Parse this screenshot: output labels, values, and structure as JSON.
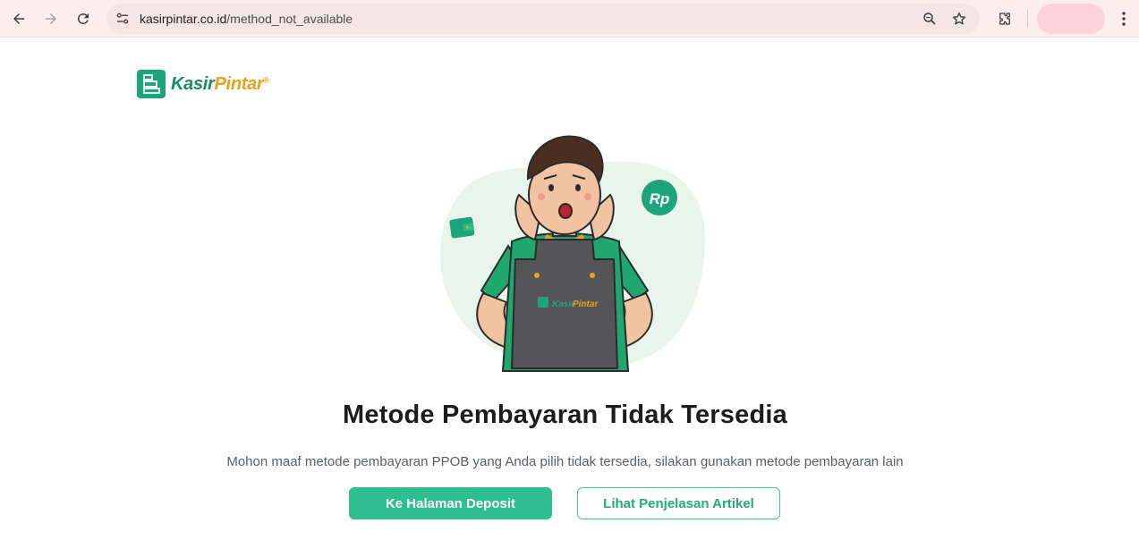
{
  "browser": {
    "url_host": "kasirpintar.co.id",
    "url_path": "/method_not_available"
  },
  "brand": {
    "logo_part1": "Kasir",
    "logo_part2": "Pintar",
    "logo_mark": "®",
    "apron_logo_part1": "Kasir",
    "apron_logo_part2": "Pintar",
    "currency_badge": "Rp",
    "primary_color": "#2fbe8f",
    "accent_color": "#e8a21a"
  },
  "main": {
    "title": "Metode Pembayaran Tidak Tersedia",
    "message": "Mohon maaf metode pembayaran PPOB yang Anda pilih tidak tersedia, silakan gunakan metode pembayaran lain",
    "primary_button": "Ke Halaman Deposit",
    "secondary_button": "Lihat Penjelasan Artikel"
  },
  "icons": {
    "back": "arrow-left-icon",
    "forward": "arrow-right-icon",
    "reload": "reload-icon",
    "site_info": "tune-icon",
    "zoom": "zoom-icon",
    "bookmark": "star-icon",
    "extensions": "puzzle-icon",
    "menu": "kebab-menu-icon",
    "wallet": "wallet-icon"
  }
}
